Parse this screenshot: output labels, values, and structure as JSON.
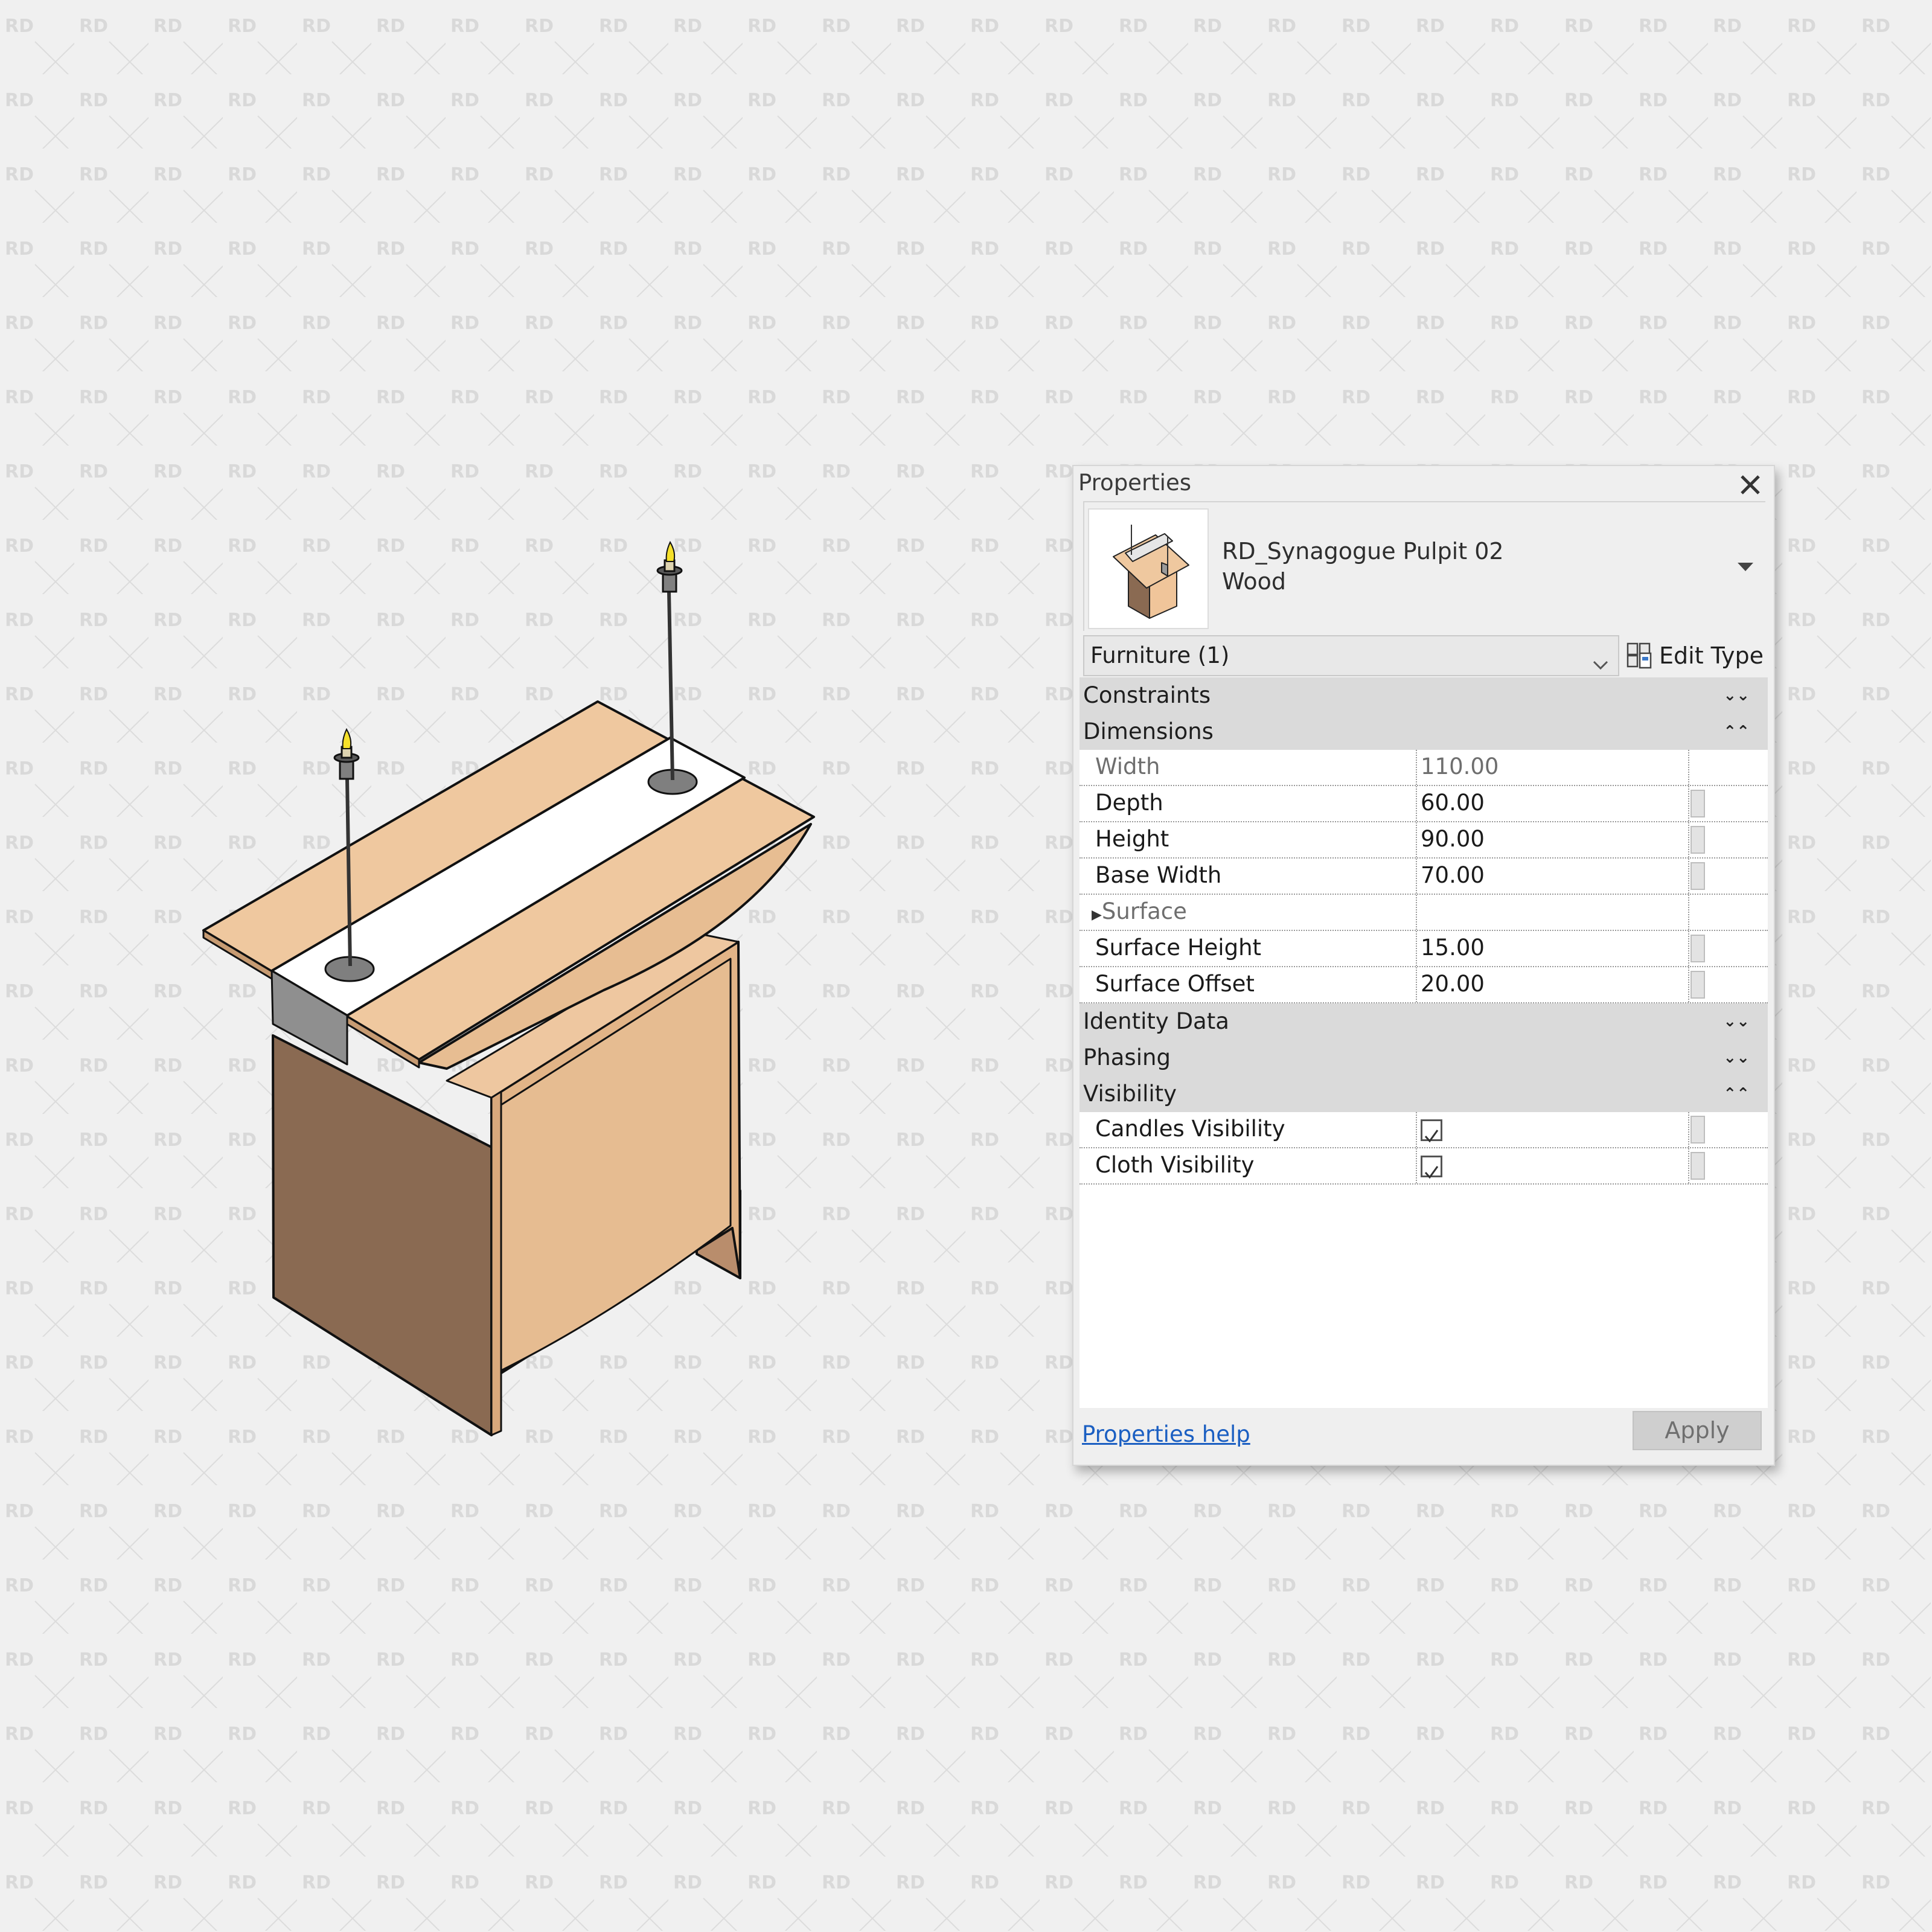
{
  "watermark": {
    "text": "RD"
  },
  "model": {
    "name": "Synagogue pulpit 3D view",
    "colors": {
      "wood_light": "#efc89f",
      "wood_mid": "#e2b487",
      "wood_dark": "#8a6a52",
      "cloth": "#ffffff",
      "cloth_side": "#8f8f8f",
      "candle_base": "#7f7f7f",
      "flame": "#f5e02a"
    }
  },
  "properties": {
    "title": "Properties",
    "close_icon": "close-icon",
    "type": {
      "family": "RD_Synagogue Pulpit 02",
      "type_name": "Wood"
    },
    "filter": {
      "selected": "Furniture (1)"
    },
    "edit_type_label": "Edit Type",
    "groups": [
      {
        "name": "Constraints",
        "state": "collapsed"
      },
      {
        "name": "Dimensions",
        "state": "expanded",
        "rows": [
          {
            "name": "Width",
            "value": "110.00",
            "editable": false
          },
          {
            "name": "Depth",
            "value": "60.00",
            "editable": true
          },
          {
            "name": "Height",
            "value": "90.00",
            "editable": true
          },
          {
            "name": "Base Width",
            "value": "70.00",
            "editable": true
          },
          {
            "name": "Surface",
            "value": "",
            "subgroup": true
          },
          {
            "name": "Surface Height",
            "value": "15.00",
            "editable": true
          },
          {
            "name": "Surface Offset",
            "value": "20.00",
            "editable": true
          }
        ]
      },
      {
        "name": "Identity Data",
        "state": "collapsed"
      },
      {
        "name": "Phasing",
        "state": "collapsed"
      },
      {
        "name": "Visibility",
        "state": "expanded",
        "rows": [
          {
            "name": "Candles Visibility",
            "checked": true
          },
          {
            "name": "Cloth Visibility",
            "checked": true
          }
        ]
      }
    ],
    "help_link": "Properties help",
    "apply_label": "Apply",
    "apply_enabled": false
  }
}
